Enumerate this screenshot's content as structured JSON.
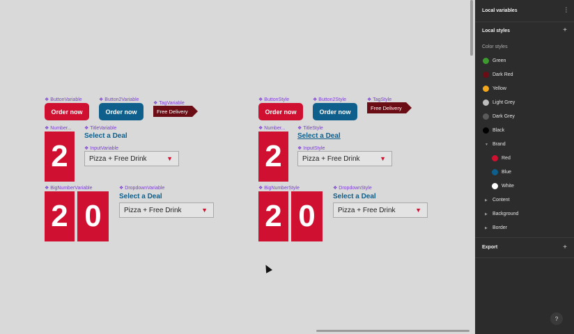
{
  "canvas": {
    "left": {
      "labels": {
        "button": "ButtonVariable",
        "button2": "Button2Variable",
        "tag": "TagVariable",
        "number": "Number...",
        "title": "TitleVariable",
        "input": "InputVariable",
        "bignumber": "BigNumberVariable",
        "dropdown": "DropdownVariable"
      },
      "button_label": "Order now",
      "button2_label": "Order now",
      "tag_label": "Free Delivery",
      "number": "2",
      "title": "Select a Deal",
      "input_value": "Pizza + Free Drink",
      "bignumber_digits": [
        "2",
        "0"
      ],
      "dropdown_title": "Select a Deal",
      "dropdown_value": "Pizza + Free Drink"
    },
    "right": {
      "labels": {
        "button": "ButtonStyle",
        "button2": "Button2Style",
        "tag": "TagStyle",
        "number": "Number...",
        "title": "TitleStyle",
        "input": "InputStyle",
        "bignumber": "BigNumberStyle",
        "dropdown": "DropdownStyle"
      },
      "button_label": "Order now",
      "button2_label": "Order now",
      "tag_label": "Free Delivery",
      "number": "2",
      "title": "Select a Deal",
      "input_value": "Pizza + Free Drink",
      "bignumber_digits": [
        "2",
        "0"
      ],
      "dropdown_title": "Select a Deal",
      "dropdown_value": "Pizza + Free Drink"
    },
    "colors": {
      "brand_red": "#cf1030",
      "brand_blue": "#0e5f8c",
      "tag_dark": "#6b0d14",
      "component_purple": "#7b3fd1"
    }
  },
  "panel": {
    "local_variables": "Local variables",
    "local_styles": "Local styles",
    "color_styles": "Color styles",
    "colors": [
      {
        "name": "Green",
        "hex": "#3c9a2f"
      },
      {
        "name": "Dark Red",
        "hex": "#6b0d14"
      },
      {
        "name": "Yellow",
        "hex": "#f2a81d"
      },
      {
        "name": "Light Grey",
        "hex": "#bdbdbd"
      },
      {
        "name": "Dark Grey",
        "hex": "#5a5a5a"
      },
      {
        "name": "Black",
        "hex": "#000000"
      }
    ],
    "brand_group": "Brand",
    "brand_colors": [
      {
        "name": "Red",
        "hex": "#cf1030"
      },
      {
        "name": "Blue",
        "hex": "#0e5f8c"
      },
      {
        "name": "White",
        "hex": "#ffffff"
      }
    ],
    "groups": [
      "Content",
      "Background",
      "Border"
    ],
    "export": "Export",
    "help": "?"
  }
}
